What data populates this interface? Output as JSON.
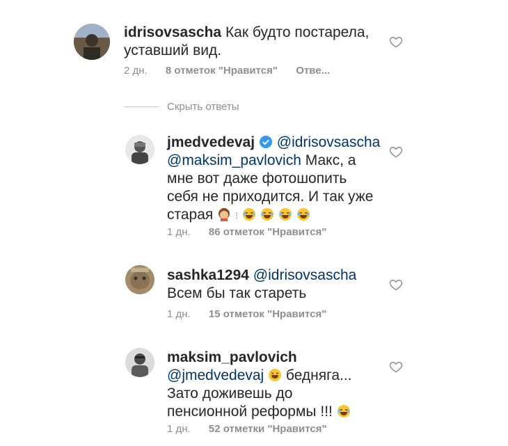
{
  "colors": {
    "username": "#262626",
    "mention": "#003569",
    "meta": "#8e8e8e",
    "verified": "#3897f0"
  },
  "hide_replies_label": "Скрыть ответы",
  "comments": [
    {
      "username": "idrisovsascha",
      "text_lines": [
        "Как будто постарела,",
        "уставший вид."
      ],
      "age": "2 дн.",
      "likes": "8 отметок \"Нравится\"",
      "reply": "Отве..."
    },
    {
      "username": "jmedvedevaj",
      "verified": true,
      "mention1": "@idrisovsascha",
      "mention2": "@maksim_pavlovich",
      "text_after_mention": "Макс, а",
      "text_lines": [
        "мне вот даже фотошопить",
        "себя не приходится. И так уже",
        "старая"
      ],
      "age": "1 дн.",
      "likes": "86 отметок \"Нравится\""
    },
    {
      "username": "sashka1294",
      "mention": "@idrisovsascha",
      "text_lines": [
        "Всем бы так стареть"
      ],
      "age": "1 дн.",
      "likes": "15 отметок \"Нравится\""
    },
    {
      "username": "maksim_pavlovich",
      "mention": "@jmedvedevaj",
      "text_after_mention": "бедняга...",
      "text_lines": [
        "Зато доживешь до",
        "пенсионной реформы !!!"
      ],
      "age": "1 дн.",
      "likes": "52 отметки \"Нравится\""
    }
  ]
}
